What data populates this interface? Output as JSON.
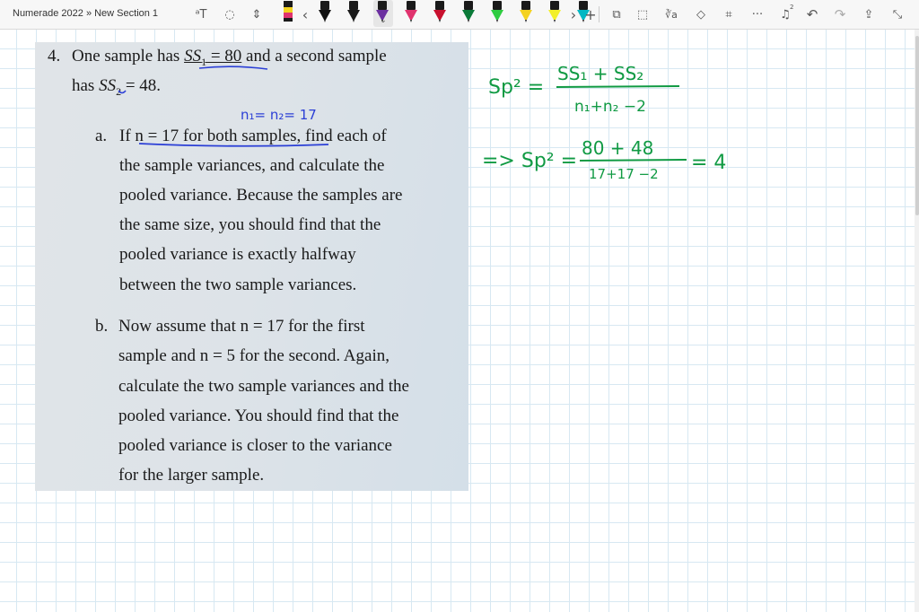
{
  "toolbar": {
    "breadcrumb": "Numerade 2022 » New Section 1",
    "tools": [
      {
        "name": "ink-to-text",
        "glyph": "ᵃT"
      },
      {
        "name": "lasso",
        "glyph": "◌"
      },
      {
        "name": "insert-space",
        "glyph": "⇕"
      }
    ],
    "pen_colors": [
      "#111111",
      "#111111",
      "#1a1a1a",
      "#6b2fa0",
      "#e0336e",
      "#c8102e",
      "#0a7a38",
      "#2ecc40",
      "#f4d21f",
      "#f2ef2a",
      "#00b7c3"
    ],
    "pen_nav_left": "‹",
    "pen_nav_right": "›",
    "selected_pen_chevron": "⌄",
    "right_tools": [
      {
        "name": "add-pen",
        "glyph": "+"
      },
      {
        "name": "shapes",
        "glyph": "⧉"
      },
      {
        "name": "ink-to-shape",
        "glyph": "⬚"
      },
      {
        "name": "ink-to-math",
        "glyph": "∛a"
      },
      {
        "name": "ruler",
        "glyph": "◇"
      },
      {
        "name": "replay",
        "glyph": "⌗"
      },
      {
        "name": "more",
        "glyph": "···"
      },
      {
        "name": "notifications",
        "glyph": "♫"
      },
      {
        "name": "undo",
        "glyph": "↶"
      },
      {
        "name": "redo",
        "glyph": "↷"
      },
      {
        "name": "share",
        "glyph": "⇪"
      },
      {
        "name": "collapse",
        "glyph": "⤡"
      }
    ],
    "notification_count": "2"
  },
  "problem": {
    "number": "4.",
    "line1_pre": "One sample has ",
    "line1_ss": "SS",
    "line1_sub": "1",
    "line1_val": " = 80",
    "line1_post": " and a second sample",
    "line2_pre": "has ",
    "line2_ss": "SS",
    "line2_sub": "2",
    "line2_post": " = 48.",
    "a_label": "a.",
    "a_lines": [
      "If n = 17 for both samples, find each of",
      "the sample variances, and calculate the",
      "pooled variance. Because the samples are",
      "the same size, you should find that the",
      "pooled variance is exactly halfway",
      "between the two sample variances."
    ],
    "b_label": "b.",
    "b_lines": [
      "Now assume that n = 17 for the first",
      "sample and n = 5 for the second. Again,",
      "calculate the two sample variances and the",
      "pooled variance. You should find that the",
      "pooled variance is closer to the variance",
      "for the larger sample."
    ]
  },
  "handwriting": {
    "n_note": "n₁= n₂= 17",
    "formula_lhs": "Sp² =",
    "formula_num": "SS₁ + SS₂",
    "formula_den": "n₁+n₂ −2",
    "calc_arrow": "=> Sp² =",
    "calc_num": "80 + 48",
    "calc_den": "17+17 −2",
    "calc_result": "= 4"
  },
  "colors": {
    "ink_blue": "#2b3fd6",
    "ink_green": "#109a43",
    "grid": "#d7e8f2",
    "clip_bg": "#dde3e8"
  }
}
